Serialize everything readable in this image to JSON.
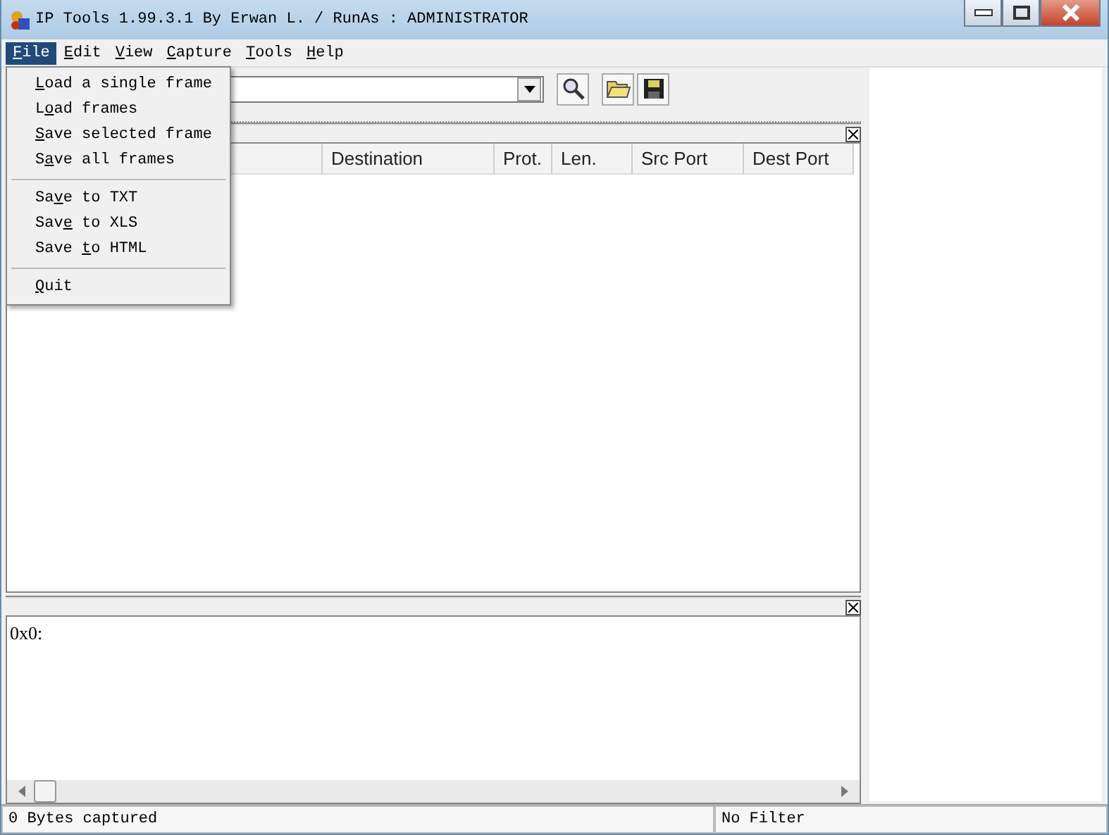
{
  "window": {
    "title": "IP Tools 1.99.3.1 By Erwan L. / RunAs : ADMINISTRATOR"
  },
  "menu_bar": [
    {
      "key": "F",
      "post": "ile",
      "selected": true
    },
    {
      "key": "E",
      "post": "dit",
      "selected": false
    },
    {
      "key": "V",
      "post": "iew",
      "selected": false
    },
    {
      "key": "C",
      "post": "apture",
      "selected": false
    },
    {
      "key": "T",
      "post": "ools",
      "selected": false
    },
    {
      "key": "H",
      "post": "elp",
      "selected": false
    }
  ],
  "file_menu": [
    {
      "kind": "item",
      "key": "L",
      "post": "oad a single frame"
    },
    {
      "kind": "item",
      "pre": "L",
      "key": "o",
      "post": "ad frames"
    },
    {
      "kind": "item",
      "key": "S",
      "post": "ave selected frame"
    },
    {
      "kind": "item",
      "pre": "S",
      "key": "a",
      "post": "ve all frames"
    },
    {
      "kind": "separator"
    },
    {
      "kind": "item",
      "pre": "Sa",
      "key": "v",
      "post": "e to TXT"
    },
    {
      "kind": "item",
      "pre": "Sav",
      "key": "e",
      "post": " to XLS"
    },
    {
      "kind": "item",
      "pre": "Save ",
      "key": "t",
      "post": "o HTML"
    },
    {
      "kind": "separator"
    },
    {
      "kind": "item",
      "key": "Q",
      "post": "uit"
    }
  ],
  "table": {
    "columns": [
      "Destination",
      "Prot.",
      "Len.",
      "Src Port",
      "Dest Port"
    ]
  },
  "hex_view": {
    "text": "0x0:"
  },
  "status_bar": [
    "0 Bytes captured",
    "No Filter"
  ]
}
